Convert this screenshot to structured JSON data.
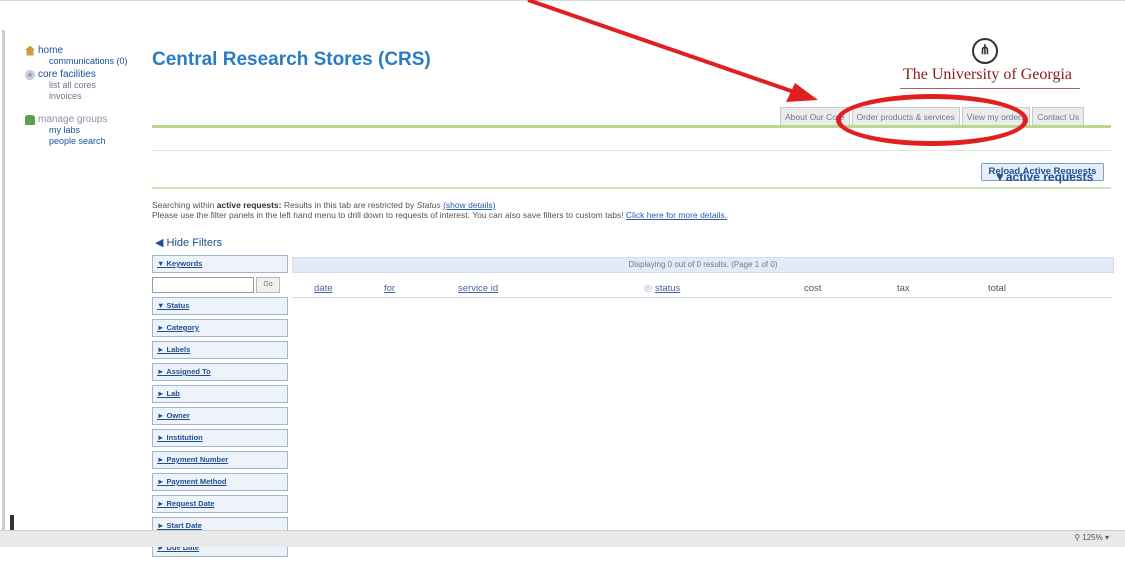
{
  "sidebar": {
    "home": "home",
    "communications": "communications (0)",
    "core_facilities": "core facilities",
    "list_all_cores": "list all cores",
    "invoices": "invoices",
    "manage_groups": "manage groups",
    "my_labs": "my labs",
    "people_search": "people search"
  },
  "header": {
    "title": "Central Research Stores (CRS)",
    "university": "The University of Georgia",
    "seal_glyph": "Ⓜ"
  },
  "tabs": [
    "About Our Core",
    "Order products & services",
    "View my orders",
    "Contact Us"
  ],
  "reload_label": "Reload Active Requests",
  "active_tab_label": "▼active requests",
  "info": {
    "prefix": "Searching within ",
    "bold": "active requests:",
    "mid": " Results in this tab are restricted by ",
    "status_word": "Status",
    "show_details": "(show details)",
    "line2": "Please use the filter panels in the left hand menu to drill down to requests of interest. You can also save filters to custom tabs! ",
    "more": "Click here for more details."
  },
  "hide_filters": "◀ Hide Filters",
  "filters": {
    "keywords": "▼ Keywords",
    "go": "Go",
    "items": [
      "▼ Status",
      "► Category",
      "► Labels",
      "► Assigned To",
      "► Lab",
      "► Owner",
      "► Institution",
      "► Payment Number",
      "► Payment Method",
      "► Request Date",
      "► Start Date",
      "► Due Date"
    ]
  },
  "results": {
    "summary": "Displaying 0 out of 0 results. (Page 1 of 0)",
    "columns": [
      "date",
      "for",
      "service id",
      "status",
      "cost",
      "tax",
      "total"
    ]
  },
  "statusbar": {
    "zoom": "125%"
  },
  "annotation_color": "#e02020"
}
